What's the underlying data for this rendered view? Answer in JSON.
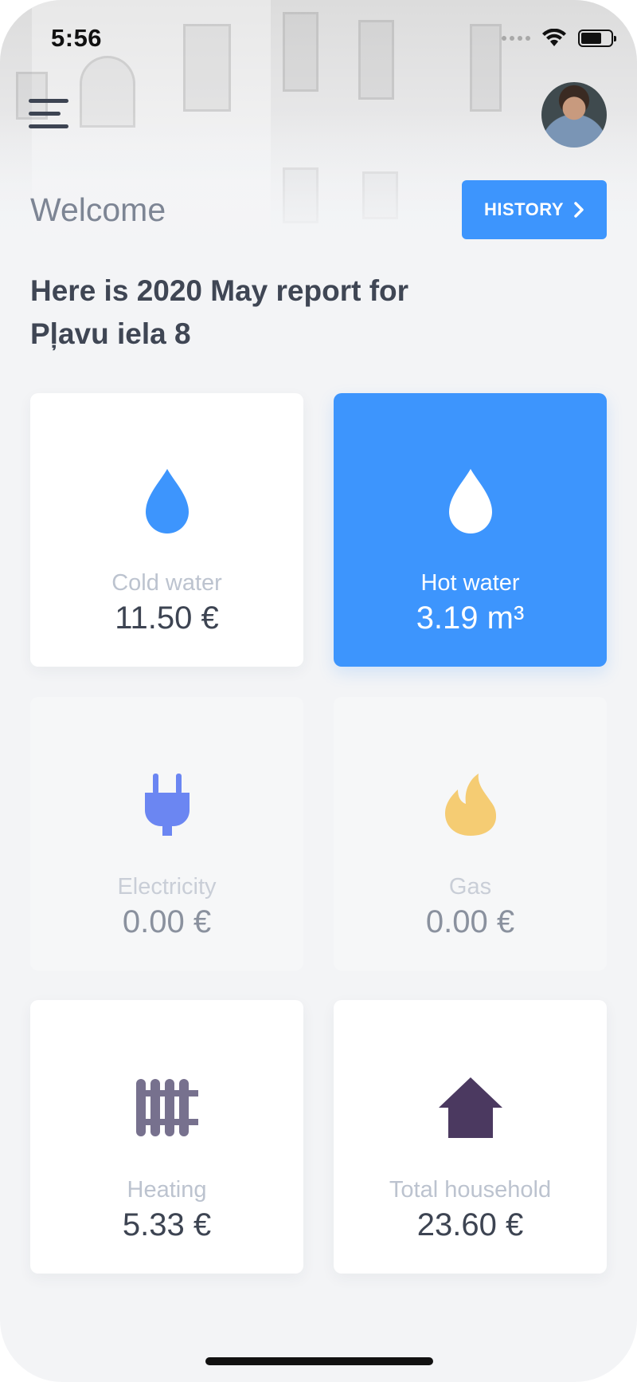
{
  "status_bar": {
    "time": "5:56"
  },
  "header": {
    "welcome": "Welcome",
    "history_label": "HISTORY",
    "report_line1": "Here is 2020 May report for",
    "report_line2": "Pļavu iela 8"
  },
  "cards": [
    {
      "label": "Cold water",
      "value": "11.50 €",
      "icon": "water-drop-icon",
      "color": "#3d95fd"
    },
    {
      "label": "Hot water",
      "value": "3.19 m³",
      "icon": "water-drop-icon",
      "color": "#ffffff"
    },
    {
      "label": "Electricity",
      "value": "0.00 €",
      "icon": "plug-icon",
      "color": "#6b86f2"
    },
    {
      "label": "Gas",
      "value": "0.00 €",
      "icon": "flame-icon",
      "color": "#f5cc73"
    },
    {
      "label": "Heating",
      "value": "5.33 €",
      "icon": "radiator-icon",
      "color": "#77718e"
    },
    {
      "label": "Total household",
      "value": "23.60 €",
      "icon": "house-icon",
      "color": "#4b3960"
    }
  ],
  "colors": {
    "accent": "#3d95fd",
    "background": "#f3f4f6",
    "text_dark": "#3d4452"
  }
}
